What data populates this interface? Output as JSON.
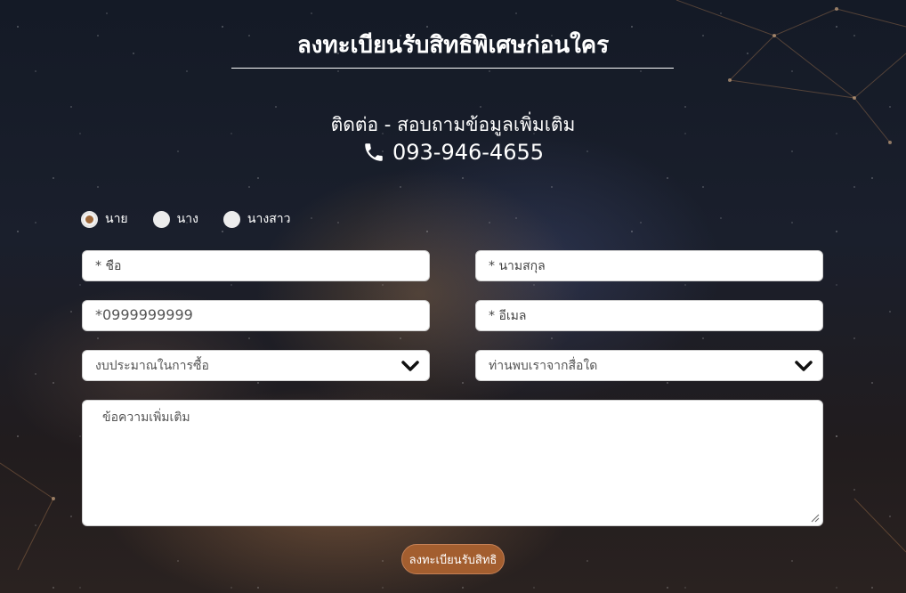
{
  "header": {
    "title": "ลงทะเบียนรับสิทธิพิเศษก่อนใคร",
    "contact_label": "ติดต่อ - สอบถามข้อมูลเพิ่มเติม",
    "phone_number": "093-946-4655",
    "phone_icon": "phone-icon"
  },
  "form": {
    "titles": [
      {
        "label": "นาย",
        "checked": true
      },
      {
        "label": "นาง",
        "checked": false
      },
      {
        "label": "นางสาว",
        "checked": false
      }
    ],
    "first_name_placeholder": "* ชื่อ",
    "last_name_placeholder": "* นามสกุล",
    "phone_placeholder": "*0999999999",
    "email_placeholder": "* อีเมล",
    "budget_select": "งบประมาณในการซื้อ",
    "source_select": "ท่านพบเราจากสื่อใด",
    "message_placeholder": "ข้อความเพิ่มเติม",
    "submit_label": "ลงทะเบียนรับสิทธิ"
  },
  "colors": {
    "accent": "#a35e2f",
    "radio_checked": "#a06a3c",
    "text": "#ffffff"
  }
}
